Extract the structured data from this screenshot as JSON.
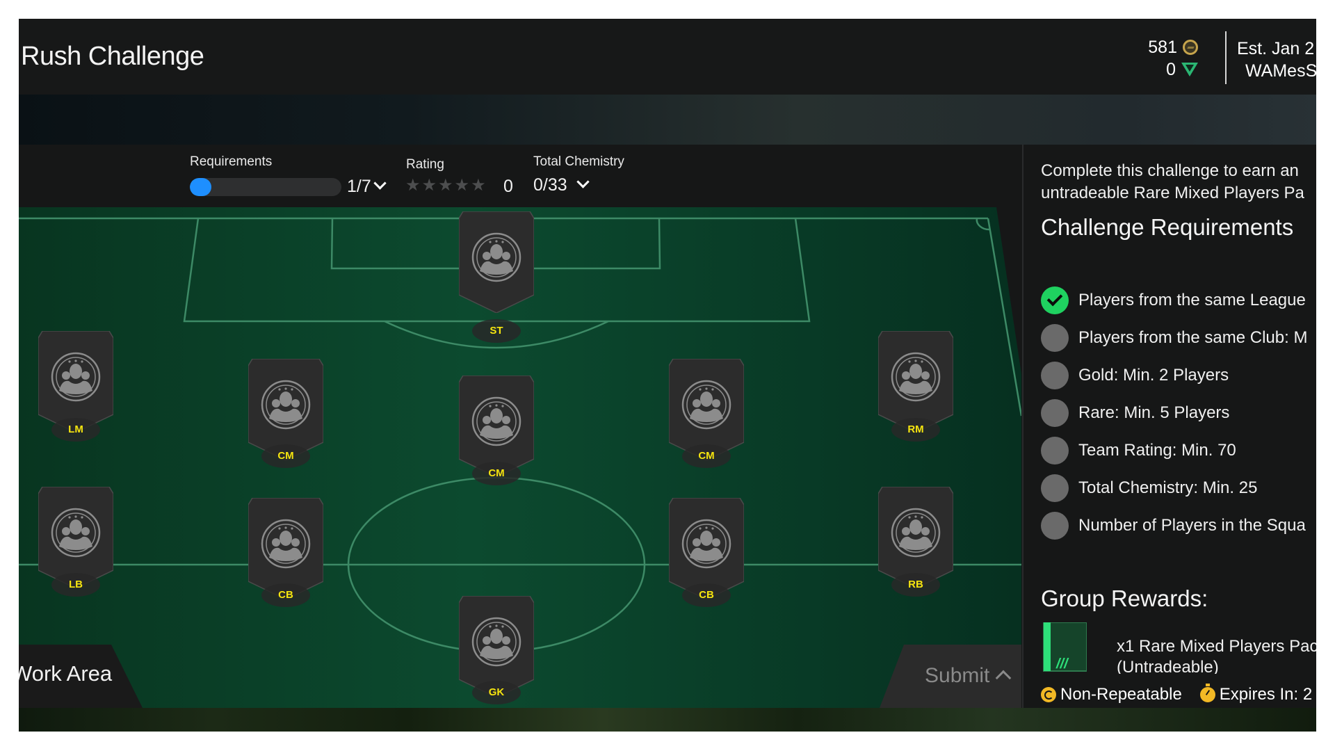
{
  "header": {
    "title": "Rush Challenge",
    "coins": "581",
    "points": "0",
    "season_line1": "Est. Jan 2",
    "season_line2": "WAMesS"
  },
  "stats": {
    "requirements_label": "Requirements",
    "requirements_value": "1/7",
    "requirements_progress": 0.143,
    "rating_label": "Rating",
    "rating_stars": "★★★★★",
    "rating_stars_filled": 0,
    "rating_value": "0",
    "chemistry_label": "Total Chemistry",
    "chemistry_value": "0/33"
  },
  "squad": {
    "positions": [
      {
        "id": "st",
        "label": "ST"
      },
      {
        "id": "lm",
        "label": "LM"
      },
      {
        "id": "cm-left",
        "label": "CM"
      },
      {
        "id": "cm-center",
        "label": "CM"
      },
      {
        "id": "cm-right",
        "label": "CM"
      },
      {
        "id": "rm",
        "label": "RM"
      },
      {
        "id": "lb",
        "label": "LB"
      },
      {
        "id": "cb-left",
        "label": "CB"
      },
      {
        "id": "cb-right",
        "label": "CB"
      },
      {
        "id": "rb",
        "label": "RB"
      },
      {
        "id": "gk",
        "label": "GK"
      }
    ]
  },
  "workarea": {
    "label": "Work Area"
  },
  "submit": {
    "label": "Submit"
  },
  "sidebar": {
    "description_line1": "Complete this challenge to earn an",
    "description_line2": "untradeable Rare Mixed Players Pa",
    "requirements_heading": "Challenge Requirements",
    "requirements": [
      {
        "text": "Players from the same League",
        "done": true
      },
      {
        "text": "Players from the same Club: M",
        "done": false
      },
      {
        "text": "Gold: Min. 2 Players",
        "done": false
      },
      {
        "text": "Rare: Min. 5 Players",
        "done": false
      },
      {
        "text": "Team Rating: Min. 70",
        "done": false
      },
      {
        "text": "Total Chemistry: Min. 25",
        "done": false
      },
      {
        "text": "Number of Players in the Squa",
        "done": false
      }
    ],
    "rewards_heading": "Group Rewards:",
    "reward_line1": "x1 Rare Mixed Players Pac",
    "reward_line2": "(Untradeable)",
    "non_repeatable": "Non-Repeatable",
    "expires": "Expires In: 2"
  },
  "colors": {
    "accent_blue": "#1e8fff",
    "complete_green": "#1fd160",
    "position_yellow": "#f5e50f",
    "pitch_green": "#0b4a2e"
  }
}
